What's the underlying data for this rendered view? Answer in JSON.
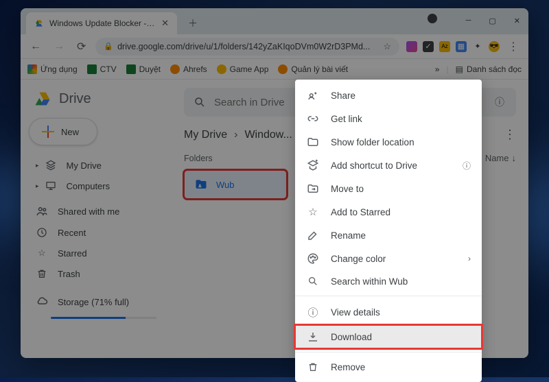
{
  "browser": {
    "tab_title": "Windows Update Blocker - Goog",
    "url": "drive.google.com/drive/u/1/folders/142yZaKIqoDVm0W2rD3PMd...",
    "bookmarks": [
      "Ứng dụng",
      "CTV",
      "Duyệt",
      "Ahrefs",
      "Game App",
      "Quản lý bài viết"
    ],
    "reading_list": "Danh sách đọc"
  },
  "drive": {
    "logo_text": "Drive",
    "new_label": "New",
    "search_placeholder": "Search in Drive",
    "sidebar": [
      "My Drive",
      "Computers",
      "Shared with me",
      "Recent",
      "Starred",
      "Trash"
    ],
    "storage_label": "Storage (71% full)",
    "storage_pct": 71,
    "breadcrumb": [
      "My Drive",
      "Window..."
    ],
    "section_label": "Folders",
    "sort_label": "Name",
    "folder_name": "Wub"
  },
  "context_menu": {
    "items": [
      {
        "icon": "share",
        "label": "Share"
      },
      {
        "icon": "link",
        "label": "Get link"
      },
      {
        "icon": "folder-open",
        "label": "Show folder location"
      },
      {
        "icon": "add-shortcut",
        "label": "Add shortcut to Drive",
        "help": true
      },
      {
        "icon": "move",
        "label": "Move to"
      },
      {
        "icon": "star",
        "label": "Add to Starred"
      },
      {
        "icon": "rename",
        "label": "Rename"
      },
      {
        "icon": "palette",
        "label": "Change color",
        "sub": true
      },
      {
        "icon": "search",
        "label": "Search within Wub"
      },
      {
        "sep": true
      },
      {
        "icon": "info",
        "label": "View details"
      },
      {
        "icon": "download",
        "label": "Download",
        "highlight": true
      },
      {
        "sep": true
      },
      {
        "icon": "trash",
        "label": "Remove"
      }
    ]
  }
}
